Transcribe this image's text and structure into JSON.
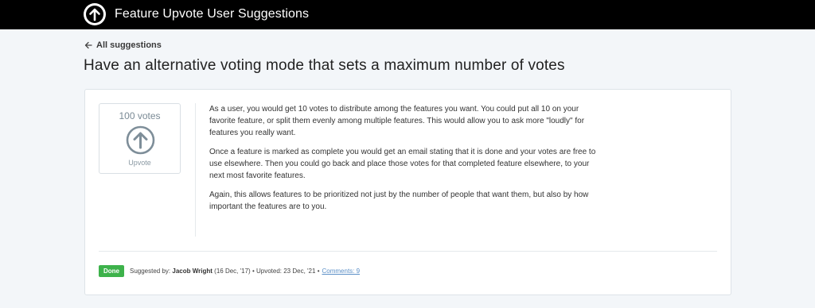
{
  "header": {
    "logo_icon": "arrow-up-circle-icon",
    "title": "Feature Upvote User Suggestions"
  },
  "nav": {
    "back_label": "All suggestions",
    "back_icon": "arrow-left-icon"
  },
  "suggestion": {
    "title": "Have an alternative voting mode that sets a maximum number of votes",
    "votes_label": "100 votes",
    "upvote_label": "Upvote",
    "upvote_icon": "arrow-up-circle-icon",
    "description": [
      "As a user, you would get 10 votes to distribute among the features you want. You could put all 10 on your favorite feature, or split them evenly among multiple features. This would allow you to ask more \"loudly\" for features you really want.",
      "Once a feature is marked as complete you would get an email stating that it is done and your votes are free to use elsewhere. Then you could go back and place those votes for that completed feature elsewhere, to your next most favorite features.",
      "Again, this allows features to be prioritized not just by the number of people that want them, but also by how important the features are to you."
    ],
    "meta": {
      "status": "Done",
      "status_color": "#3db24b",
      "suggested_by_prefix": "Suggested by:",
      "author": "Jacob Wright",
      "suggested_date": "(16 Dec, '17)",
      "separator": "•",
      "upvoted": "Upvoted: 23 Dec, '21",
      "comments": "Comments: 9"
    }
  },
  "colors": {
    "topbar": "#000000",
    "background": "#f3f6f9",
    "link": "#5b8fc7"
  }
}
